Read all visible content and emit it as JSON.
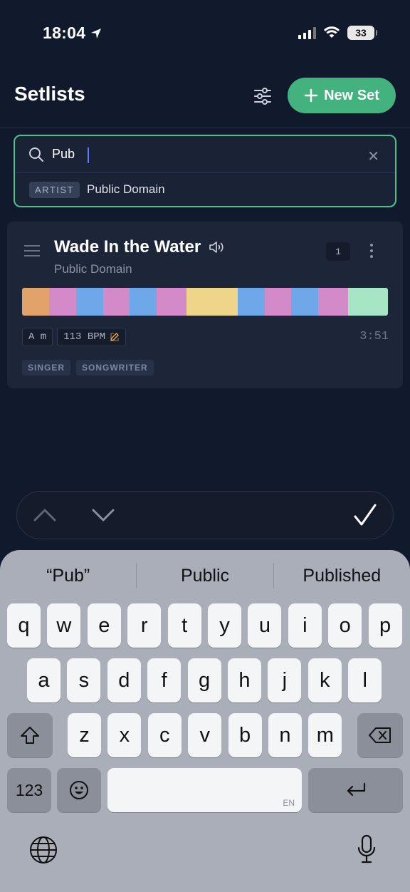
{
  "status_bar": {
    "time": "18:04",
    "battery": "33"
  },
  "header": {
    "title": "Setlists",
    "new_set_label": "New Set"
  },
  "search": {
    "value": "Pub",
    "suggestion": {
      "tag": "ARTIST",
      "text": "Public Domain"
    }
  },
  "song": {
    "title": "Wade In the Water",
    "artist": "Public Domain",
    "count": "1",
    "key": "A m",
    "bpm": "113 BPM",
    "duration": "3:51",
    "roles": [
      "SINGER",
      "SONGWRITER"
    ],
    "section_colors": [
      {
        "color": "#e2a36a",
        "weight": 38
      },
      {
        "color": "#d28ac8",
        "weight": 38
      },
      {
        "color": "#6fa8e8",
        "weight": 38
      },
      {
        "color": "#d28ac8",
        "weight": 38
      },
      {
        "color": "#6fa8e8",
        "weight": 38
      },
      {
        "color": "#d28ac8",
        "weight": 42
      },
      {
        "color": "#eed589",
        "weight": 72
      },
      {
        "color": "#6fa8e8",
        "weight": 38
      },
      {
        "color": "#d28ac8",
        "weight": 38
      },
      {
        "color": "#6fa8e8",
        "weight": 38
      },
      {
        "color": "#d28ac8",
        "weight": 42
      },
      {
        "color": "#a6e6c4",
        "weight": 56
      }
    ]
  },
  "keyboard": {
    "predictions": [
      "“Pub”",
      "Public",
      "Published"
    ],
    "row1": [
      "q",
      "w",
      "e",
      "r",
      "t",
      "y",
      "u",
      "i",
      "o",
      "p"
    ],
    "row2": [
      "a",
      "s",
      "d",
      "f",
      "g",
      "h",
      "j",
      "k",
      "l"
    ],
    "row3": [
      "z",
      "x",
      "c",
      "v",
      "b",
      "n",
      "m"
    ],
    "numbers_label": "123",
    "space_lang": "EN"
  },
  "colors": {
    "accent": "#44b27f",
    "background": "#111a2c",
    "card": "#1d2638"
  }
}
